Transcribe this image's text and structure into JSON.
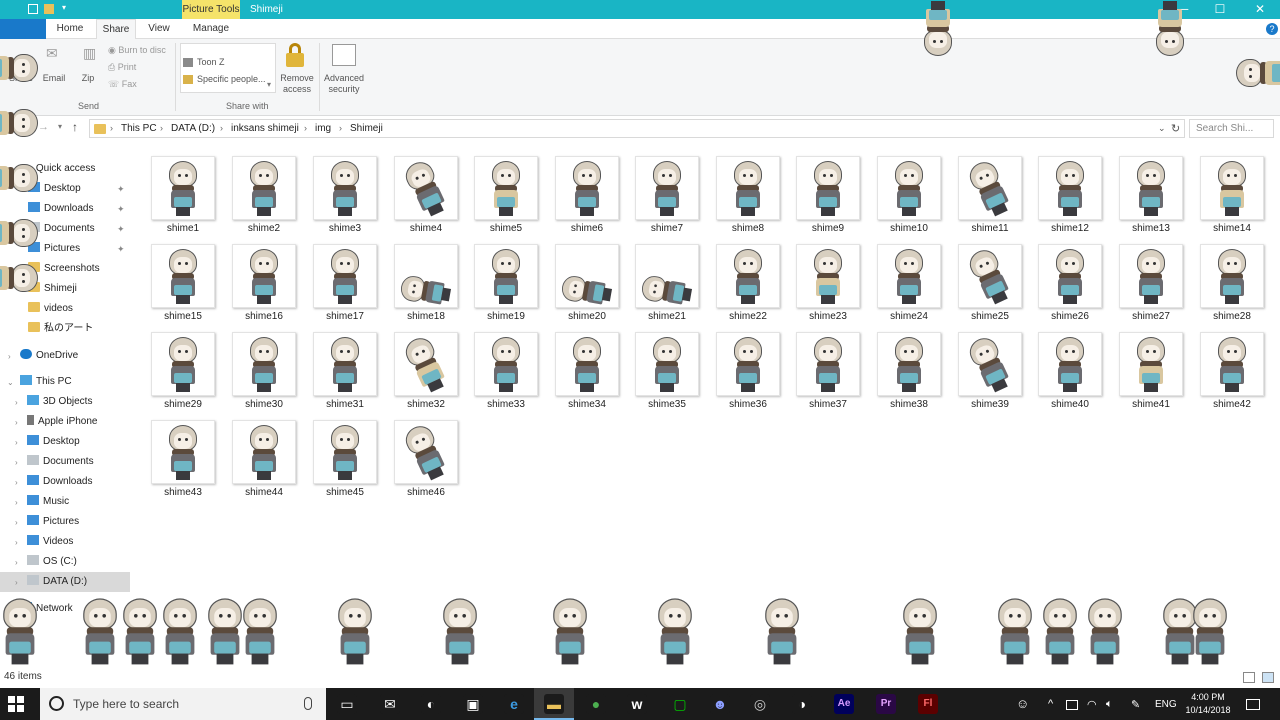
{
  "window": {
    "title": "Shimeji",
    "context_tab": "Picture Tools"
  },
  "ribbon": {
    "tabs": [
      "Home",
      "Share",
      "View",
      "Manage"
    ],
    "active_tab": "Share",
    "send": {
      "share_label": "Share",
      "email_label": "Email",
      "zip_label": "Zip",
      "burn_label": "Burn to disc",
      "print_label": "Print",
      "fax_label": "Fax",
      "group_label": "Send"
    },
    "share_with": {
      "entries": [
        "Toon Z",
        "Specific people..."
      ],
      "remove_label": "Remove access",
      "group_label": "Share with"
    },
    "advanced_label": "Advanced security"
  },
  "address": {
    "crumbs": [
      "This PC",
      "DATA (D:)",
      "inksans shimeji",
      "img",
      "Shimeji"
    ],
    "search_placeholder": "Search Shi..."
  },
  "sidebar": {
    "quick_access": "Quick access",
    "quick_items": [
      "Desktop",
      "Downloads",
      "Documents",
      "Pictures",
      "Screenshots",
      "Shimeji",
      "videos",
      "私のアート"
    ],
    "onedrive": "OneDrive",
    "this_pc": "This PC",
    "pc_items": [
      "3D Objects",
      "Apple iPhone",
      "Desktop",
      "Documents",
      "Downloads",
      "Music",
      "Pictures",
      "Videos",
      "OS (C:)",
      "DATA (D:)"
    ],
    "network": "Network"
  },
  "files": [
    "shime1",
    "shime2",
    "shime3",
    "shime4",
    "shime5",
    "shime6",
    "shime7",
    "shime8",
    "shime9",
    "shime10",
    "shime11",
    "shime12",
    "shime13",
    "shime14",
    "shime15",
    "shime16",
    "shime17",
    "shime18",
    "shime19",
    "shime20",
    "shime21",
    "shime22",
    "shime23",
    "shime24",
    "shime25",
    "shime26",
    "shime27",
    "shime28",
    "shime29",
    "shime30",
    "shime31",
    "shime32",
    "shime33",
    "shime34",
    "shime35",
    "shime36",
    "shime37",
    "shime38",
    "shime39",
    "shime40",
    "shime41",
    "shime42",
    "shime43",
    "shime44",
    "shime45",
    "shime46"
  ],
  "status": {
    "items": "46 items"
  },
  "taskbar": {
    "search_placeholder": "Type here to search",
    "language": "ENG",
    "time": "4:00 PM",
    "date": "10/14/2018",
    "apps": [
      "task-view",
      "mail",
      "steam",
      "store",
      "edge",
      "file-explorer",
      "chrome",
      "wattpad",
      "line",
      "discord",
      "app-circle",
      "app-swirl",
      "after-effects",
      "premiere-pro",
      "flash"
    ],
    "app_labels": [
      "Ae",
      "Pr",
      "Fl"
    ]
  },
  "colors": {
    "titlebar": "#19b5c5",
    "context_tab": "#f5e36a",
    "file_tab": "#1979ca",
    "taskbar": "#1b1b1b"
  }
}
